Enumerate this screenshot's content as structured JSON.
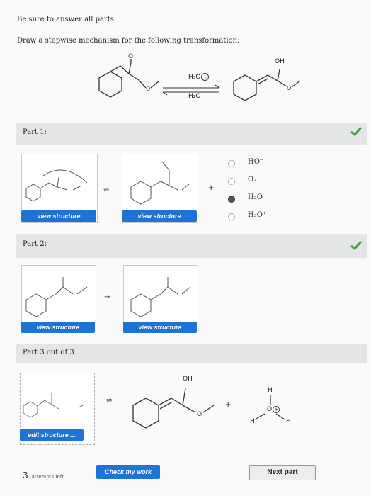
{
  "instructions": {
    "line1": "Be sure to answer all parts.",
    "line2": "Draw a stepwise mechanism for the following transformation:"
  },
  "reaction": {
    "reagent_top": "H₃O",
    "reagent_bottom": "H₂O",
    "product_label": "OH"
  },
  "part1": {
    "label": "Part 1:",
    "button1": "view structure",
    "button2": "view structure",
    "options": [
      {
        "label": "HO⁻",
        "selected": false
      },
      {
        "label": "O₂",
        "selected": false
      },
      {
        "label": "H₂O",
        "selected": true
      },
      {
        "label": "H₃O⁺",
        "selected": false
      }
    ],
    "plus": "+"
  },
  "part2": {
    "label": "Part 2:",
    "button1": "view structure",
    "button2": "view structure"
  },
  "part3": {
    "label": "Part 3 out of 3",
    "edit_button": "edit structure ...",
    "oh_label": "OH",
    "water_h_top": "H",
    "water_o": "O",
    "water_h_left": "H",
    "water_h_right": "H",
    "plus": "+"
  },
  "footer": {
    "attempts_number": "3",
    "attempts_text": "attempts left",
    "check_button": "Check my work",
    "next_button": "Next part"
  },
  "colors": {
    "accent": "#1e73d6",
    "check_green": "#3aa832"
  }
}
